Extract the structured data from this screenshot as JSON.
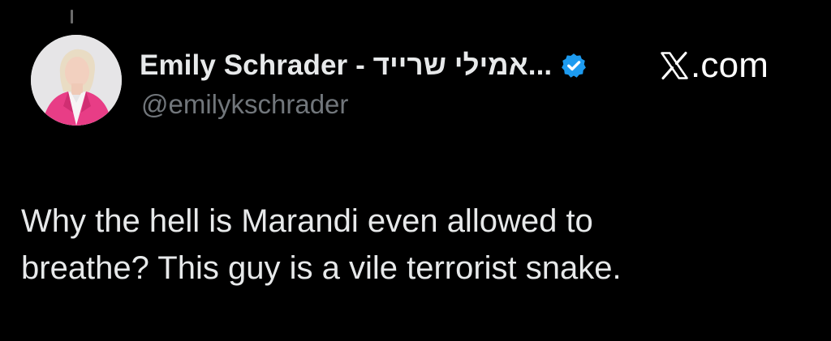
{
  "author": {
    "display_name": "Emily Schrader - אמילי שרייד...",
    "handle": "@emilykschrader",
    "avatar_icon": "profile-photo",
    "verified_icon": "verified-badge-icon",
    "verified_color": "#1d9bf0"
  },
  "brand": {
    "logo_icon": "x-logo-icon",
    "label": ".com"
  },
  "tweet": {
    "lines": [
      "Why the hell is Marandi even allowed to",
      "breathe? This guy is a vile terrorist snake."
    ]
  },
  "colors": {
    "background": "#000000",
    "text_primary": "#e7e9ea",
    "text_secondary": "#71767b"
  }
}
